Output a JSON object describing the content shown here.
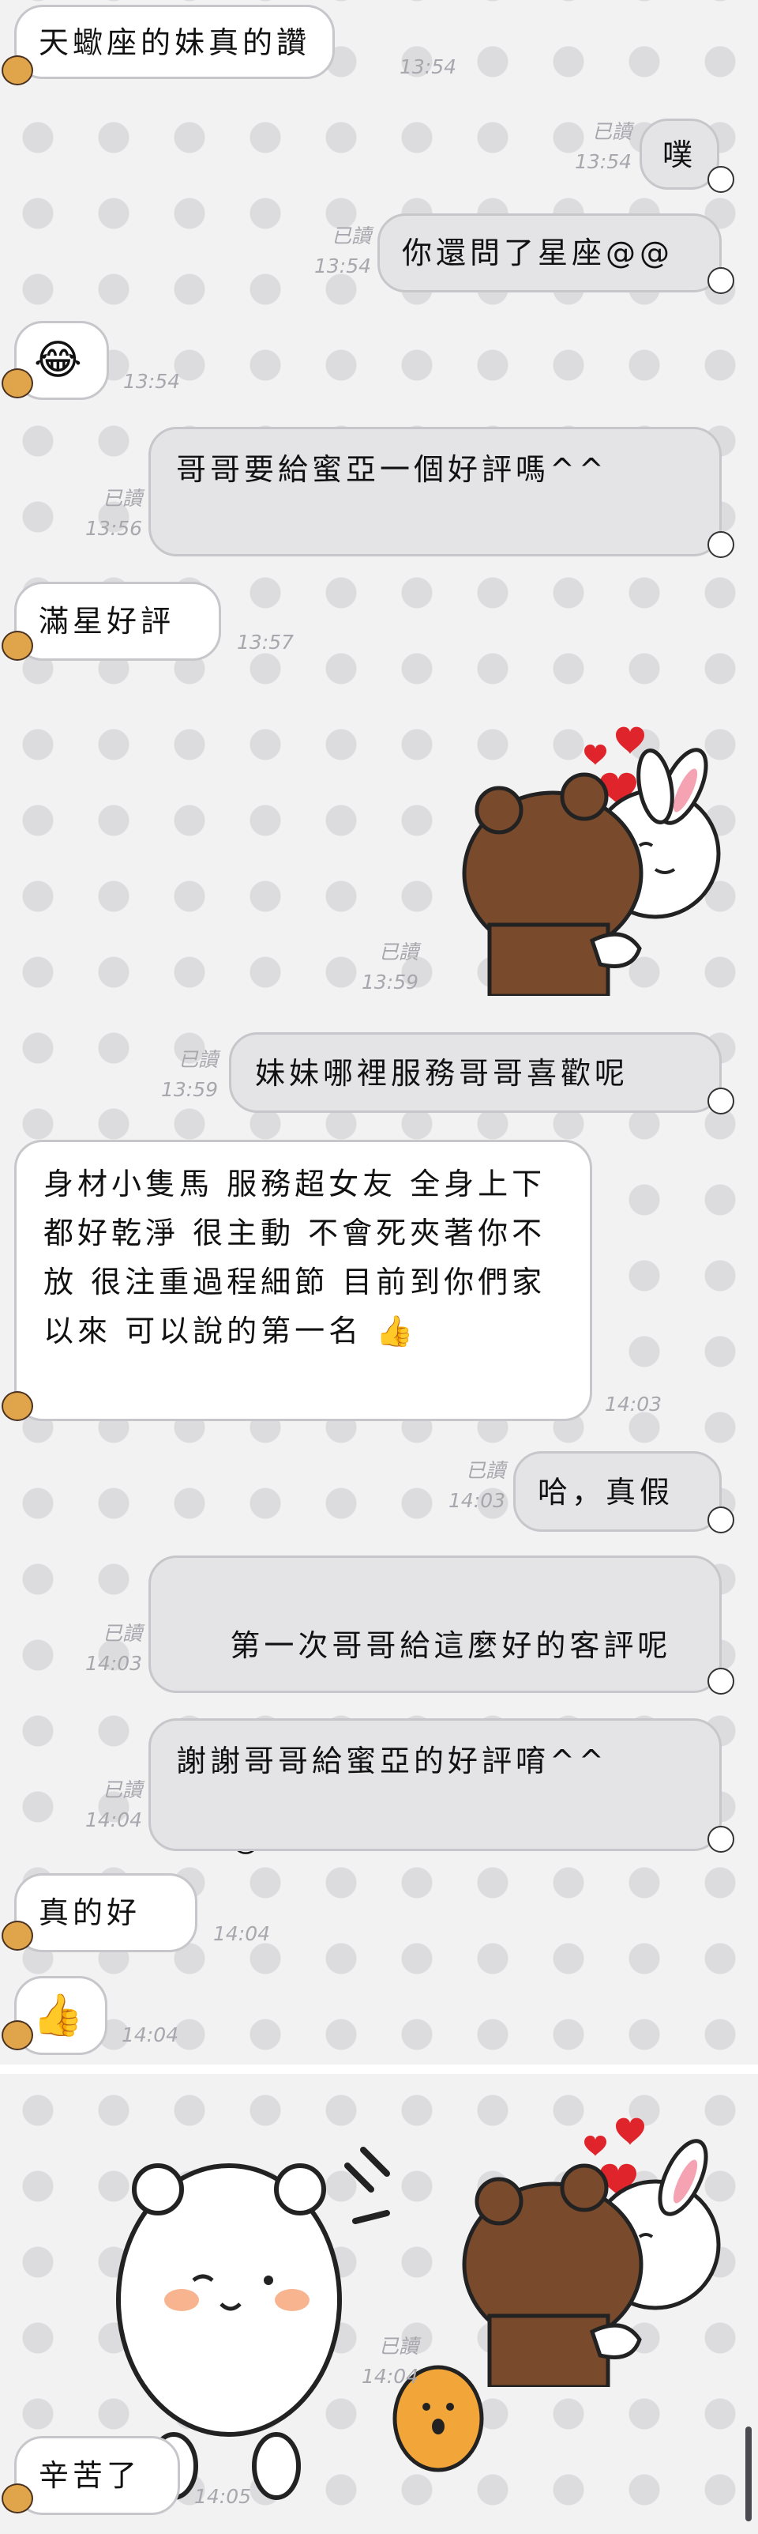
{
  "messages": [
    {
      "id": "m1",
      "text": "天蠍座的妹真的讚",
      "time": "13:54"
    },
    {
      "id": "m2",
      "text": "噗",
      "time": "13:54",
      "read": "已讀"
    },
    {
      "id": "m3",
      "text": "你還問了星座@@",
      "time": "13:54",
      "read": "已讀"
    },
    {
      "id": "m4",
      "text": "😂",
      "time": "13:54"
    },
    {
      "id": "m5",
      "text": "哥哥要給蜜亞一個好評嗎^^",
      "time": "13:56",
      "read": "已讀"
    },
    {
      "id": "m6",
      "text": "滿星好評",
      "time": "13:57"
    },
    {
      "id": "m7",
      "sticker": "bear-hugging-bunny-hearts-sticker",
      "time": "13:59",
      "read": "已讀"
    },
    {
      "id": "m8",
      "text": "妹妹哪裡服務哥哥喜歡呢",
      "time": "13:59",
      "read": "已讀"
    },
    {
      "id": "m9",
      "text": "身材小隻馬 服務超女友 全身上下都好乾淨 很主動 不會死夾著你不放 很注重過程細節 目前到你們家以來 可以說的第一名 👍",
      "time": "14:03"
    },
    {
      "id": "m10",
      "text": "哈，真假",
      "time": "14:03",
      "read": "已讀"
    },
    {
      "id": "m11",
      "text": "第一次哥哥給這麼好的客評呢",
      "emoji": [
        "😁",
        "😁",
        "😁"
      ],
      "time": "14:03",
      "read": "已讀"
    },
    {
      "id": "m12",
      "text": "謝謝哥哥給蜜亞的好評唷^^",
      "time": "14:04",
      "read": "已讀"
    },
    {
      "id": "m13",
      "text": "真的好",
      "time": "14:04"
    },
    {
      "id": "m14",
      "text": "👍",
      "time": "14:04"
    },
    {
      "id": "m15",
      "sticker": "white-bear-waving-sticker",
      "time": "14:04",
      "read": "已讀"
    },
    {
      "id": "m16",
      "sticker": "bear-hugging-bunny-hearts-sticker",
      "time": "14:04",
      "read": "已讀"
    },
    {
      "id": "m17",
      "text": "辛苦了",
      "time": "14:05"
    }
  ],
  "colors": {
    "background": "#f2f2f3",
    "dots": "#dcdcdf",
    "incoming_bubble": "#ffffff",
    "outgoing_bubble": "#e4e4e7",
    "bubble_border": "#c7c7cb",
    "meta_text": "#a7a7ad",
    "heart": "#e0242b",
    "brown_bear": "#7a4a2c",
    "bunny": "#ffffff"
  },
  "icons": {
    "avatar": "sender-avatar-icon",
    "tail": "bubble-tail-icon",
    "thumbs_up": "thumbs-up-emoji",
    "laugh": "laughing-crying-emoji",
    "grin": "grinning-face-emoji"
  }
}
